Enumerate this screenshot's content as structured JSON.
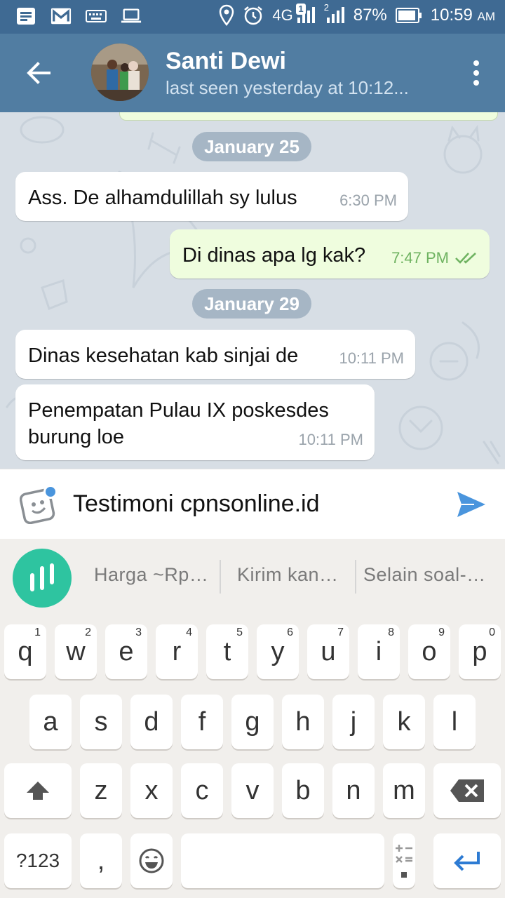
{
  "status_bar": {
    "network": "4G",
    "sim_badge": "1",
    "sim2": "2",
    "battery": "87%",
    "time": "10:59",
    "ampm": "AM",
    "left_icons": [
      "notes-icon",
      "gmail-icon",
      "keyboard-icon",
      "laptop-icon"
    ],
    "right_icons": [
      "location-icon",
      "alarm-icon",
      "signal-icon",
      "battery-icon"
    ]
  },
  "header": {
    "name": "Santi Dewi",
    "last_seen": "last seen yesterday at 10:12..."
  },
  "chat": {
    "items": [
      {
        "type": "date",
        "text": "January 25"
      },
      {
        "type": "in",
        "text": "Ass. De alhamdulillah sy lulus",
        "time": "6:30 PM"
      },
      {
        "type": "out",
        "text": "Di dinas apa lg kak?",
        "time": "7:47 PM",
        "status": "read"
      },
      {
        "type": "date",
        "text": "January 29"
      },
      {
        "type": "in",
        "text": "Dinas kesehatan kab sinjai de",
        "time": "10:11 PM"
      },
      {
        "type": "in",
        "lines": [
          "Penempatan Pulau IX poskesdes",
          "burung loe"
        ],
        "time": "10:11 PM"
      }
    ]
  },
  "composer": {
    "text": "Testimoni cpnsonline.id"
  },
  "keyboard": {
    "suggestions": [
      "Harga ~Rp…",
      "Kirim kan…",
      "Selain soal-…"
    ],
    "row1": [
      {
        "k": "q",
        "n": "1"
      },
      {
        "k": "w",
        "n": "2"
      },
      {
        "k": "e",
        "n": "3"
      },
      {
        "k": "r",
        "n": "4"
      },
      {
        "k": "t",
        "n": "5"
      },
      {
        "k": "y",
        "n": "6"
      },
      {
        "k": "u",
        "n": "7"
      },
      {
        "k": "i",
        "n": "8"
      },
      {
        "k": "o",
        "n": "9"
      },
      {
        "k": "p",
        "n": "0"
      }
    ],
    "row2": [
      "a",
      "s",
      "d",
      "f",
      "g",
      "h",
      "j",
      "k",
      "l"
    ],
    "row3": [
      "z",
      "x",
      "c",
      "v",
      "b",
      "n",
      "m"
    ],
    "symbols_label": "?123",
    "comma": ","
  },
  "colors": {
    "header": "#517da2",
    "status_bar": "#3f6a93",
    "outgoing_bubble": "#effdde",
    "read_check": "#6fb361",
    "send_icon": "#4a95dd",
    "swiftkey": "#2ec4a0"
  }
}
